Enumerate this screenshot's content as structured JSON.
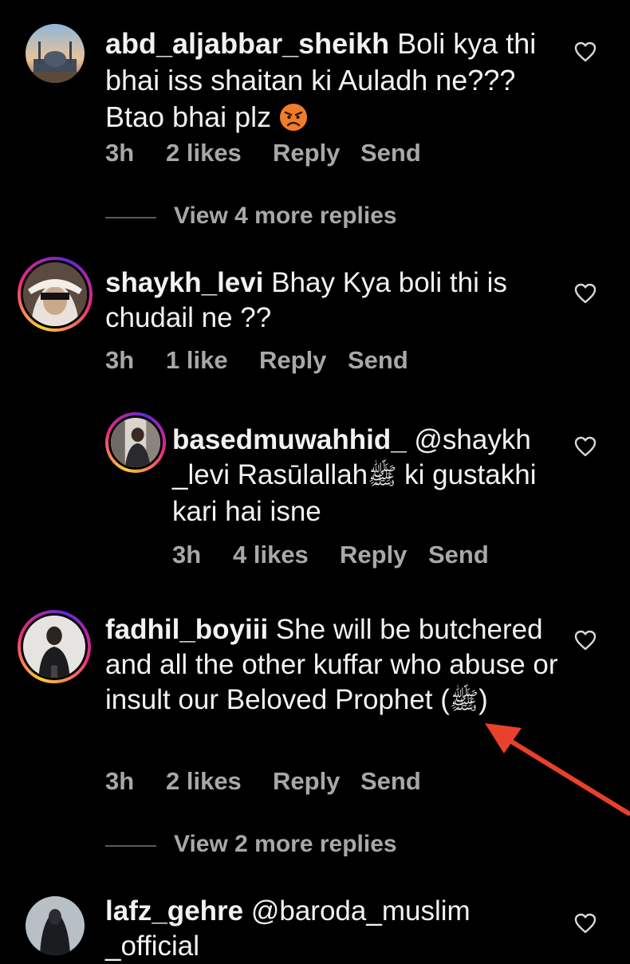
{
  "comments": [
    {
      "username": "abd_aljabbar_sheikh",
      "text": " Boli kya thi bhai iss shaitan ki Auladh ne??? Btao bhai plz ",
      "time": "3h",
      "likes": "2 likes",
      "reply": "Reply",
      "send": "Send",
      "view_more": "View 4 more replies"
    },
    {
      "username": "shaykh_levi",
      "text": " Bhay Kya boli thi is chudail ne ??",
      "time": "3h",
      "likes": "1 like",
      "reply": "Reply",
      "send": "Send"
    },
    {
      "username": "basedmuwahhid_",
      "mention": " @shaykh _levi",
      "text_a": " Rasūlallah",
      "saw": "ﷺ",
      "text_b": " ki gustakhi kari hai isne",
      "time": "3h",
      "likes": "4 likes",
      "reply": "Reply",
      "send": "Send"
    },
    {
      "username": "fadhil_boyiii",
      "text_a": " She will be butchered and all the other kuffar who abuse or insult our Beloved Prophet (",
      "saw": "ﷺ",
      "text_b": ")",
      "time": "3h",
      "likes": "2 likes",
      "reply": "Reply",
      "send": "Send",
      "view_more": "View 2 more replies"
    },
    {
      "username": "lafz_gehre",
      "mention": " @baroda_muslim _official"
    }
  ],
  "icons": {
    "like": "heart-outline-icon",
    "angry_emoji": "angry-face-emoji",
    "annotation": "red-arrow"
  },
  "colors": {
    "background": "#000000",
    "text": "#f2f2f2",
    "meta": "#a8a8a8",
    "arrow": "#e8412c"
  }
}
